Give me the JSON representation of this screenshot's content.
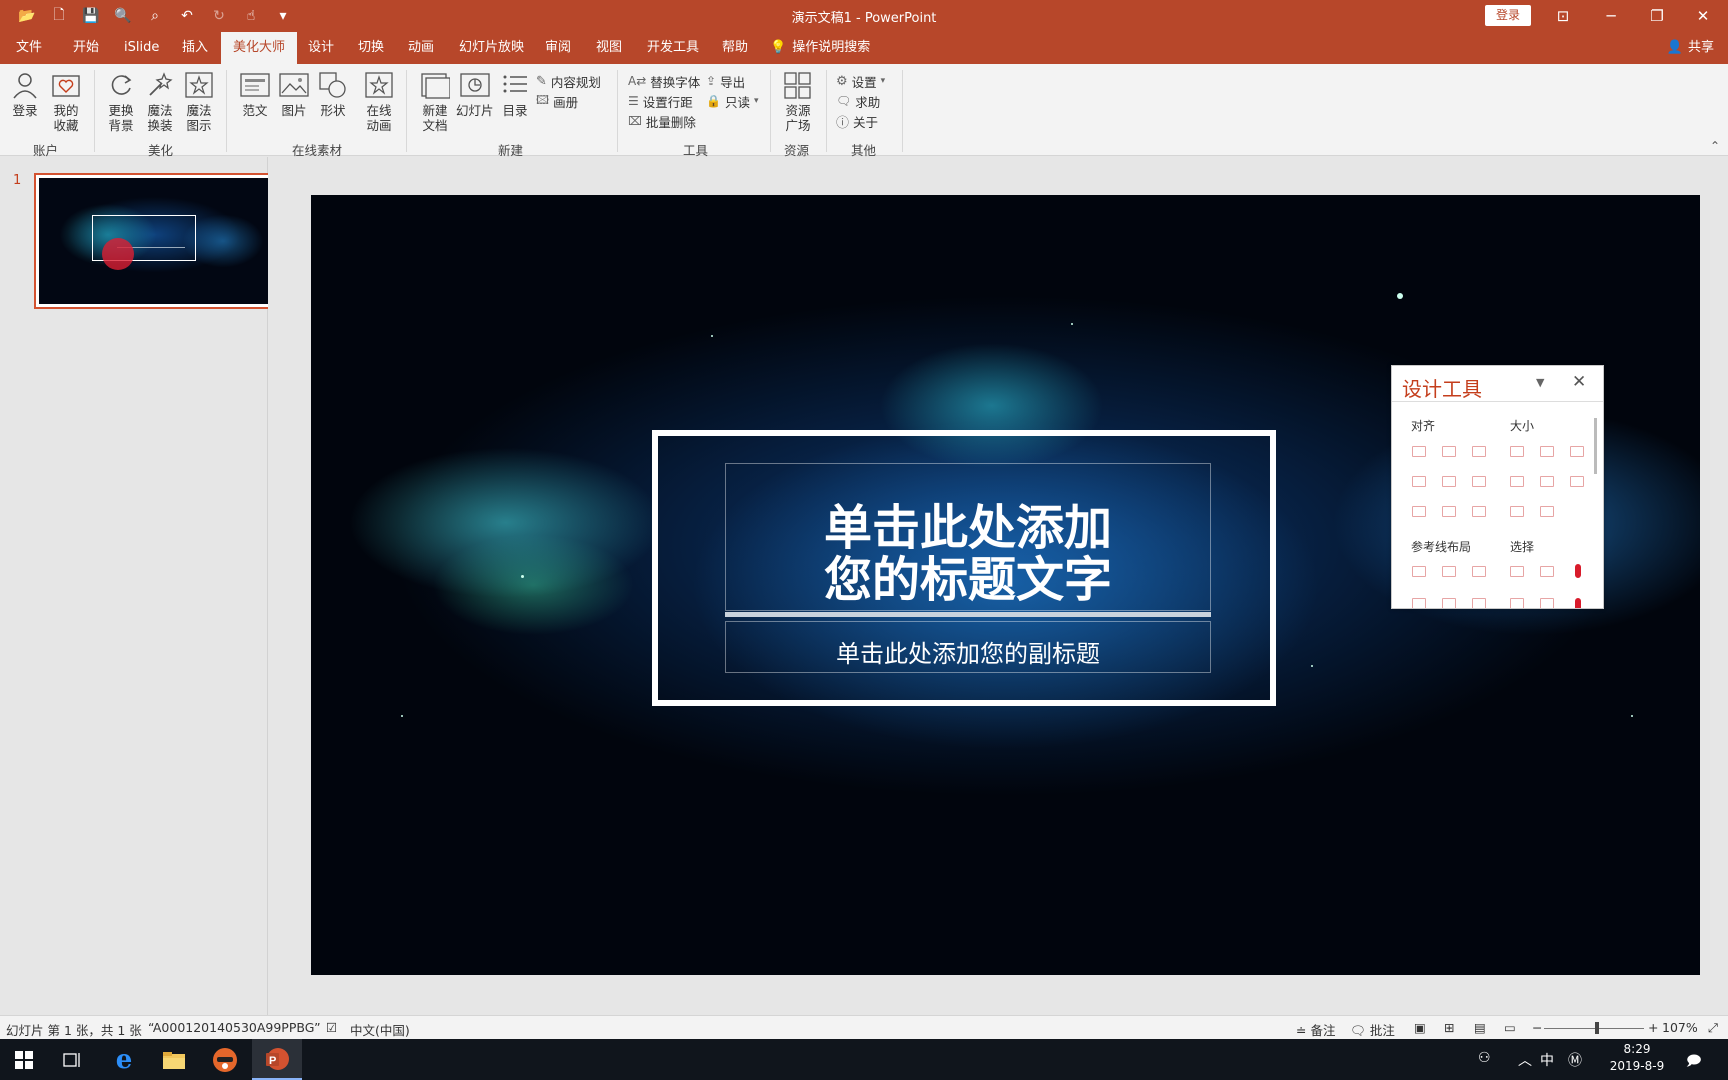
{
  "window": {
    "title": "演示文稿1  -  PowerPoint",
    "login": "登录",
    "controls": [
      "restore-ribbon",
      "minimize",
      "maximize",
      "close"
    ]
  },
  "menu": {
    "tabs": [
      "文件",
      "开始",
      "iSlide",
      "插入",
      "美化大师",
      "设计",
      "切换",
      "动画",
      "幻灯片放映",
      "审阅",
      "视图",
      "开发工具",
      "帮助"
    ],
    "active_tab": "美化大师",
    "search": "操作说明搜索",
    "share": "共享"
  },
  "ribbon": {
    "account": {
      "login": "登录",
      "favorites": "我的\n收藏",
      "label": "账户"
    },
    "beautify": {
      "change_bg": "更换\n背景",
      "magic_replace": "魔法\n换装",
      "magic_diagram": "魔法\n图示",
      "label": "美化"
    },
    "online": {
      "template": "范文",
      "picture": "图片",
      "shape": "形状",
      "online_anim": "在线\n动画",
      "label": "在线素材"
    },
    "new": {
      "new_doc": "新建\n文档",
      "slide": "幻灯片",
      "toc": "目录",
      "content_plan": "内容规划",
      "album": "画册",
      "label": "新建"
    },
    "tools": {
      "replace_font": "替换字体",
      "line_spacing": "设置行距",
      "batch_delete": "批量删除",
      "export": "导出",
      "read_only": "只读",
      "label": "工具"
    },
    "resources": {
      "resource_plaza": "资源\n广场",
      "label": "资源"
    },
    "other": {
      "settings": "设置",
      "help": "求助",
      "about": "关于",
      "label": "其他"
    }
  },
  "thumbnails": {
    "slide_number": "1"
  },
  "slide": {
    "title_line1": "单击此处添加",
    "title_line2": "您的标题文字",
    "subtitle": "单击此处添加您的副标题"
  },
  "design_tool": {
    "title": "设计工具",
    "align": "对齐",
    "size": "大小",
    "guides": "参考线布局",
    "select": "选择"
  },
  "status": {
    "slide_info": "幻灯片 第 1 张，共 1 张",
    "theme": "“A000120140530A99PPBG”",
    "language": "中文(中国)",
    "notes": "备注",
    "comments": "批注",
    "zoom": "107%",
    "zoom_level": 0.53
  },
  "taskbar": {
    "time": "8:29",
    "date": "2019-8-9",
    "ime": "中"
  },
  "colors": {
    "accent": "#b7472a",
    "tool_red": "#c43e1c"
  }
}
